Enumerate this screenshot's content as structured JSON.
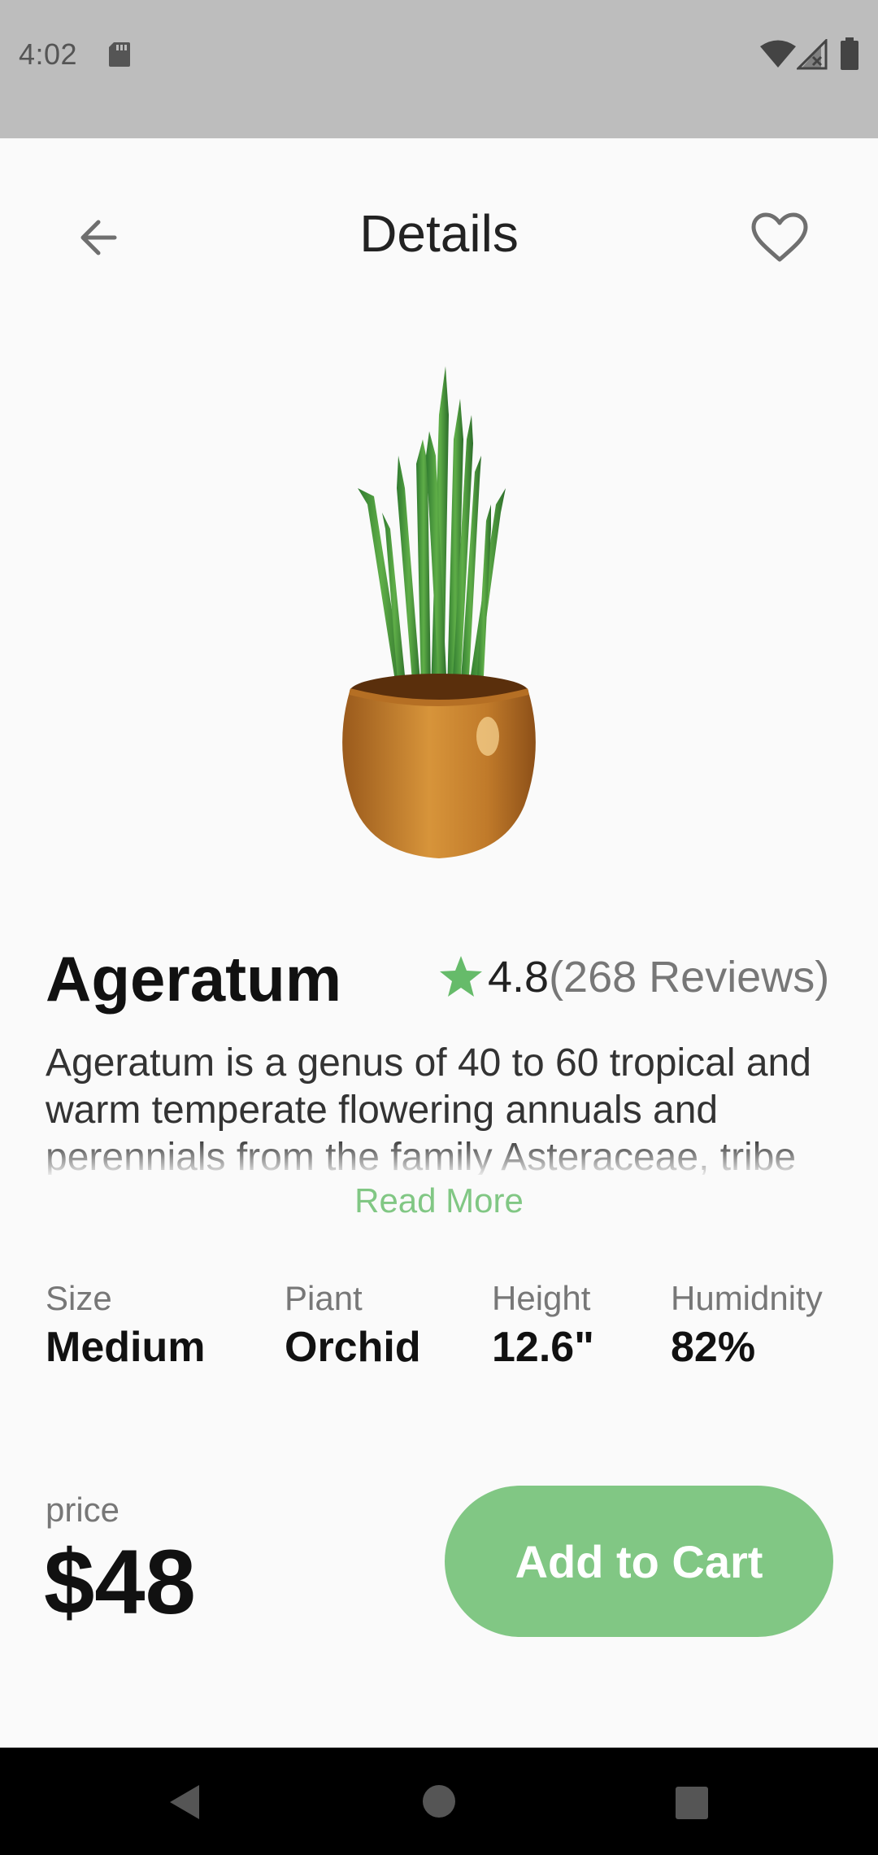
{
  "status_bar": {
    "time": "4:02",
    "icons": [
      "sd-card-icon",
      "wifi-icon",
      "signal-icon",
      "battery-icon"
    ]
  },
  "header": {
    "title": "Details",
    "back_icon": "arrow-left-icon",
    "favorite_icon": "heart-outline-icon"
  },
  "product": {
    "name": "Ageratum",
    "rating": "4.8",
    "reviews": "(268 Reviews)",
    "description": "Ageratum is a genus of 40 to 60 tropical and warm temperate flowering annuals and perennials from the family Asteraceae, tribe",
    "read_more": "Read More",
    "specs": [
      {
        "label": "Size",
        "value": "Medium"
      },
      {
        "label": "Piant",
        "value": "Orchid"
      },
      {
        "label": "Height",
        "value": "12.6\""
      },
      {
        "label": "Humidnity",
        "value": "82%"
      }
    ],
    "price_label": "price",
    "price": "$48",
    "cart_button": "Add to Cart"
  },
  "colors": {
    "accent": "#81c784",
    "status_bar": "#bdbdbd",
    "background": "#fafafa",
    "nav_bar": "#000000"
  },
  "nav_bar": {
    "icons": [
      "back-triangle-icon",
      "home-circle-icon",
      "recents-square-icon"
    ]
  }
}
